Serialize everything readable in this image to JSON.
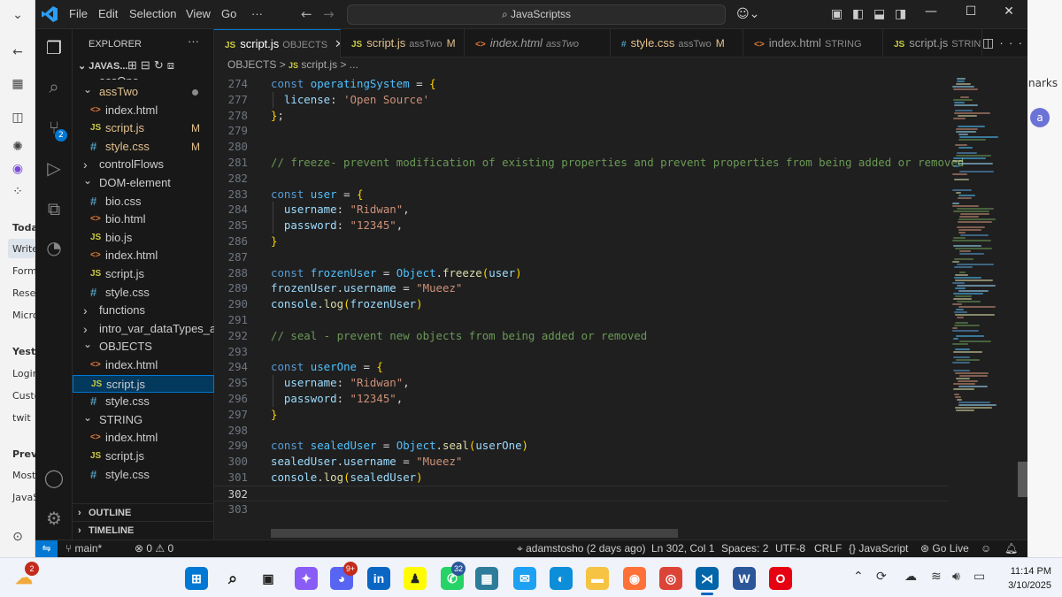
{
  "browser": {
    "right_text": "narks",
    "avatar": "a",
    "left_labels": [
      "Today",
      "Write",
      "Form",
      "Rese",
      "Micro",
      "Yester",
      "Login",
      "Custo",
      "twit",
      "Previc",
      "Most",
      "JavaS"
    ]
  },
  "titlebar": {
    "menu": [
      "File",
      "Edit",
      "Selection",
      "View",
      "Go"
    ],
    "more": "···",
    "search": "JavaScriptss"
  },
  "activity": {
    "source_control_badge": "2"
  },
  "explorer": {
    "title": "EXPLORER",
    "root": "JAVAS...",
    "items": [
      {
        "label": "assOne",
        "type": "folder",
        "indent": 1,
        "open": false,
        "partial": true
      },
      {
        "label": "assTwo",
        "type": "folder",
        "indent": 1,
        "open": true,
        "modified_dot": true,
        "mod_color": true
      },
      {
        "label": "index.html",
        "type": "html",
        "indent": 2
      },
      {
        "label": "script.js",
        "type": "js",
        "indent": 2,
        "mod": "M"
      },
      {
        "label": "style.css",
        "type": "css",
        "indent": 2,
        "mod": "M"
      },
      {
        "label": "controlFlows",
        "type": "folder",
        "indent": 1,
        "open": false
      },
      {
        "label": "DOM-element",
        "type": "folder",
        "indent": 1,
        "open": true
      },
      {
        "label": "bio.css",
        "type": "css",
        "indent": 2
      },
      {
        "label": "bio.html",
        "type": "html",
        "indent": 2
      },
      {
        "label": "bio.js",
        "type": "js",
        "indent": 2
      },
      {
        "label": "index.html",
        "type": "html",
        "indent": 2
      },
      {
        "label": "script.js",
        "type": "js",
        "indent": 2
      },
      {
        "label": "style.css",
        "type": "css",
        "indent": 2
      },
      {
        "label": "functions",
        "type": "folder",
        "indent": 1,
        "open": false
      },
      {
        "label": "intro_var_dataTypes_a...",
        "type": "folder",
        "indent": 1,
        "open": false
      },
      {
        "label": "OBJECTS",
        "type": "folder",
        "indent": 1,
        "open": true
      },
      {
        "label": "index.html",
        "type": "html",
        "indent": 2
      },
      {
        "label": "script.js",
        "type": "js",
        "indent": 2,
        "selected": true
      },
      {
        "label": "style.css",
        "type": "css",
        "indent": 2
      },
      {
        "label": "STRING",
        "type": "folder",
        "indent": 1,
        "open": true
      },
      {
        "label": "index.html",
        "type": "html",
        "indent": 2
      },
      {
        "label": "script.js",
        "type": "js",
        "indent": 2
      },
      {
        "label": "style.css",
        "type": "css",
        "indent": 2
      }
    ],
    "sections": [
      "OUTLINE",
      "TIMELINE"
    ]
  },
  "tabs": [
    {
      "icon": "JS",
      "label": "script.js",
      "desc": "OBJECTS",
      "active": true,
      "close": "✕"
    },
    {
      "icon": "JS",
      "label": "script.js",
      "desc": "assTwo",
      "mod": "M"
    },
    {
      "icon": "<>",
      "label": "index.html",
      "desc": "assTwo"
    },
    {
      "icon": "#",
      "label": "style.css",
      "desc": "assTwo",
      "mod": "M"
    },
    {
      "icon": "<>",
      "label": "index.html",
      "desc": "STRING"
    },
    {
      "icon": "JS",
      "label": "script.js",
      "desc": "STRIN"
    }
  ],
  "breadcrumb": [
    "OBJECTS",
    ">",
    "JS",
    "script.js",
    ">",
    "..."
  ],
  "code": [
    {
      "n": "274",
      "t": [
        [
          "k",
          "const "
        ],
        [
          "v",
          "operatingSystem"
        ],
        [
          "w",
          " = "
        ],
        [
          "p",
          "{"
        ]
      ]
    },
    {
      "n": "277",
      "t": [
        [
          "w",
          "  "
        ],
        [
          "pr",
          "license"
        ],
        [
          "w",
          ": "
        ],
        [
          "s",
          "'Open Source'"
        ]
      ],
      "guide": true
    },
    {
      "n": "278",
      "t": [
        [
          "p",
          "}"
        ],
        [
          "w",
          ";"
        ]
      ]
    },
    {
      "n": "279",
      "t": []
    },
    {
      "n": "280",
      "t": []
    },
    {
      "n": "281",
      "t": [
        [
          "c",
          "// freeze- prevent modification of existing properties and prevent properties from being added or removed"
        ]
      ]
    },
    {
      "n": "282",
      "t": []
    },
    {
      "n": "283",
      "t": [
        [
          "k",
          "const "
        ],
        [
          "v",
          "user"
        ],
        [
          "w",
          " = "
        ],
        [
          "p",
          "{"
        ]
      ]
    },
    {
      "n": "284",
      "t": [
        [
          "w",
          "  "
        ],
        [
          "pr",
          "username"
        ],
        [
          "w",
          ": "
        ],
        [
          "s",
          "\"Ridwan\""
        ],
        [
          "w",
          ","
        ]
      ],
      "guide": true
    },
    {
      "n": "285",
      "t": [
        [
          "w",
          "  "
        ],
        [
          "pr",
          "password"
        ],
        [
          "w",
          ": "
        ],
        [
          "s",
          "\"12345\""
        ],
        [
          "w",
          ","
        ]
      ],
      "guide": true
    },
    {
      "n": "286",
      "t": [
        [
          "p",
          "}"
        ]
      ]
    },
    {
      "n": "287",
      "t": []
    },
    {
      "n": "288",
      "t": [
        [
          "k",
          "const "
        ],
        [
          "v",
          "frozenUser"
        ],
        [
          "w",
          " = "
        ],
        [
          "v",
          "Object"
        ],
        [
          "w",
          "."
        ],
        [
          "f",
          "freeze"
        ],
        [
          "p",
          "("
        ],
        [
          "pr",
          "user"
        ],
        [
          "p",
          ")"
        ]
      ]
    },
    {
      "n": "289",
      "t": [
        [
          "pr",
          "frozenUser"
        ],
        [
          "w",
          "."
        ],
        [
          "pr",
          "username"
        ],
        [
          "w",
          " = "
        ],
        [
          "s",
          "\"Mueez\""
        ]
      ]
    },
    {
      "n": "290",
      "t": [
        [
          "pr",
          "console"
        ],
        [
          "w",
          "."
        ],
        [
          "f",
          "log"
        ],
        [
          "p",
          "("
        ],
        [
          "pr",
          "frozenUser"
        ],
        [
          "p",
          ")"
        ]
      ]
    },
    {
      "n": "291",
      "t": []
    },
    {
      "n": "292",
      "t": [
        [
          "c",
          "// seal - prevent new objects from being added or removed"
        ]
      ]
    },
    {
      "n": "293",
      "t": []
    },
    {
      "n": "294",
      "t": [
        [
          "k",
          "const "
        ],
        [
          "v",
          "userOne"
        ],
        [
          "w",
          " = "
        ],
        [
          "p",
          "{"
        ]
      ]
    },
    {
      "n": "295",
      "t": [
        [
          "w",
          "  "
        ],
        [
          "pr",
          "username"
        ],
        [
          "w",
          ": "
        ],
        [
          "s",
          "\"Ridwan\""
        ],
        [
          "w",
          ","
        ]
      ],
      "guide": true
    },
    {
      "n": "296",
      "t": [
        [
          "w",
          "  "
        ],
        [
          "pr",
          "password"
        ],
        [
          "w",
          ": "
        ],
        [
          "s",
          "\"12345\""
        ],
        [
          "w",
          ","
        ]
      ],
      "guide": true
    },
    {
      "n": "297",
      "t": [
        [
          "p",
          "}"
        ]
      ]
    },
    {
      "n": "298",
      "t": []
    },
    {
      "n": "299",
      "t": [
        [
          "k",
          "const "
        ],
        [
          "v",
          "sealedUser"
        ],
        [
          "w",
          " = "
        ],
        [
          "v",
          "Object"
        ],
        [
          "w",
          "."
        ],
        [
          "f",
          "seal"
        ],
        [
          "p",
          "("
        ],
        [
          "pr",
          "userOne"
        ],
        [
          "p",
          ")"
        ]
      ]
    },
    {
      "n": "300",
      "t": [
        [
          "pr",
          "sealedUser"
        ],
        [
          "w",
          "."
        ],
        [
          "pr",
          "username"
        ],
        [
          "w",
          " = "
        ],
        [
          "s",
          "\"Mueez\""
        ]
      ]
    },
    {
      "n": "301",
      "t": [
        [
          "pr",
          "console"
        ],
        [
          "w",
          "."
        ],
        [
          "f",
          "log"
        ],
        [
          "p",
          "("
        ],
        [
          "pr",
          "sealedUser"
        ],
        [
          "p",
          ")"
        ]
      ]
    },
    {
      "n": "302",
      "t": [],
      "current": true
    },
    {
      "n": "303",
      "t": []
    }
  ],
  "status": {
    "branch": "main*",
    "problems": "0",
    "warnings": "0",
    "blame": "adamstosho (2 days ago)",
    "cursor": "Ln 302, Col 1",
    "spaces": "Spaces: 2",
    "encoding": "UTF-8",
    "eol": "CRLF",
    "language": "JavaScript",
    "golive": "Go Live"
  },
  "taskbar": {
    "weather_badge": "2",
    "discord_badge": "9+",
    "whatsapp_badge": "32",
    "time": "11:14 PM",
    "date": "3/10/2025"
  }
}
